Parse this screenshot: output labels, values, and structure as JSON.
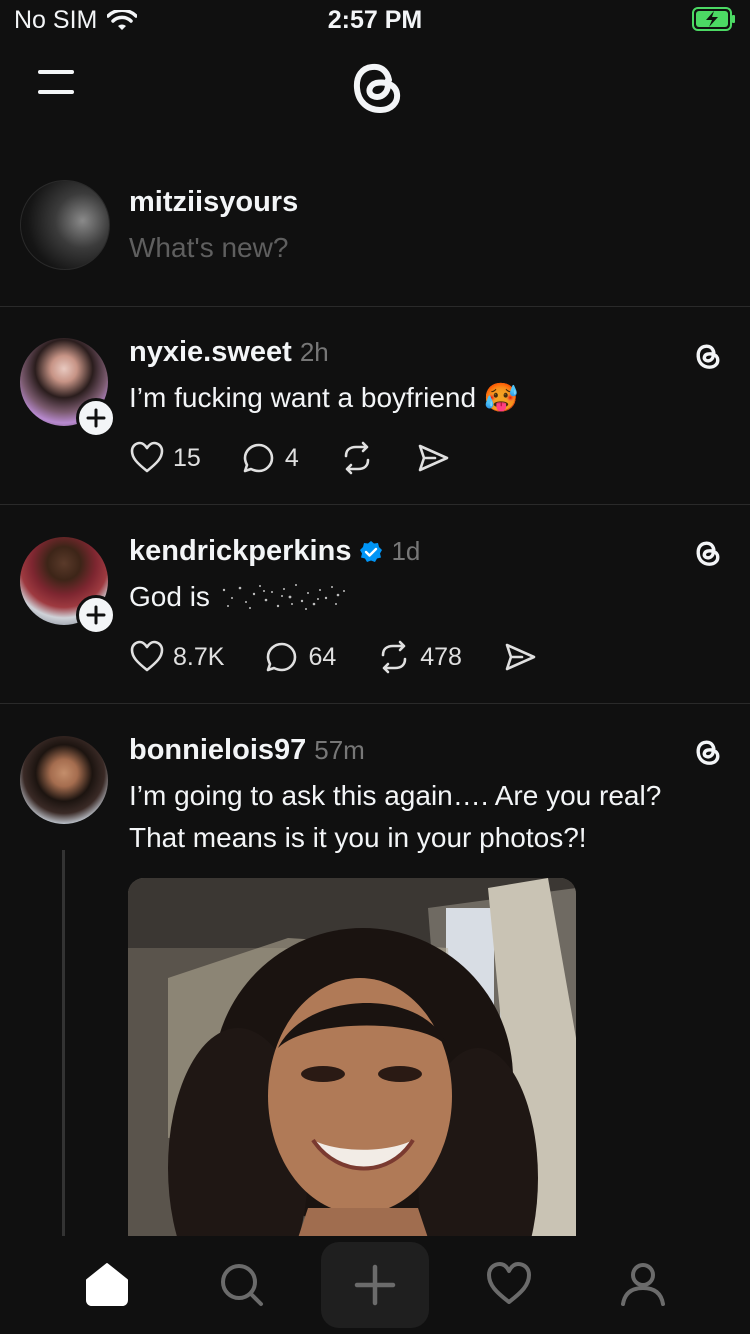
{
  "status": {
    "carrier": "No SIM",
    "time": "2:57 PM"
  },
  "composer": {
    "username": "mitziisyours",
    "placeholder": "What's new?"
  },
  "posts": [
    {
      "username": "nyxie.sweet",
      "time": "2h",
      "text": "I’m fucking want a boyfriend",
      "emoji": "🥵",
      "likes": "15",
      "replies": "4",
      "reposts": "",
      "verified": false
    },
    {
      "username": "kendrickperkins",
      "time": "1d",
      "text": "God is",
      "likes": "8.7K",
      "replies": "64",
      "reposts": "478",
      "verified": true
    },
    {
      "username": "bonnielois97",
      "time": "57m",
      "text_line1": "I’m going to ask this again…. Are you real?",
      "text_line2": "That means is it you in your photos?!",
      "verified": false
    }
  ],
  "icons": {
    "menu": "menu-icon",
    "logo": "threads-logo-icon",
    "like": "heart-icon",
    "reply": "comment-icon",
    "repost": "repost-icon",
    "share": "send-icon",
    "tabs": [
      "home-icon",
      "search-icon",
      "plus-icon",
      "heart-icon",
      "profile-icon"
    ]
  },
  "colors": {
    "background": "#101010",
    "text": "#f3f5f7",
    "muted": "#777777",
    "verified": "#0095f6",
    "battery": "#4cd964"
  }
}
